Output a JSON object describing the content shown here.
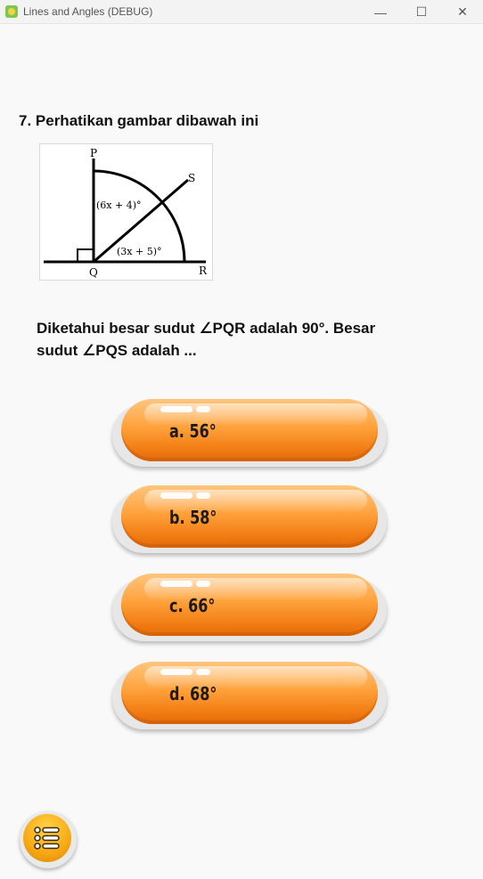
{
  "window": {
    "title": "Lines and Angles (DEBUG)",
    "minimize_glyph": "—",
    "maximize_glyph": "☐",
    "close_glyph": "✕"
  },
  "question": {
    "text": "7. Perhatikan gambar dibawah ini",
    "figure": {
      "labels": {
        "p": "P",
        "s": "S",
        "q": "Q",
        "r": "R",
        "angle_pqs": "(6x + 4)°",
        "angle_sqr": "(3x + 5)°"
      }
    },
    "statement": "Diketahui besar sudut  ∠PQR adalah 90°. Besar sudut  ∠PQS adalah ..."
  },
  "options": [
    {
      "label": "a. 56°"
    },
    {
      "label": "b. 58°"
    },
    {
      "label": "c. 66°"
    },
    {
      "label": "d. 68°"
    }
  ],
  "colors": {
    "button_orange": "#f7931e",
    "menu_yellow": "#f7a812"
  },
  "icons": {
    "menu": "list-icon"
  }
}
